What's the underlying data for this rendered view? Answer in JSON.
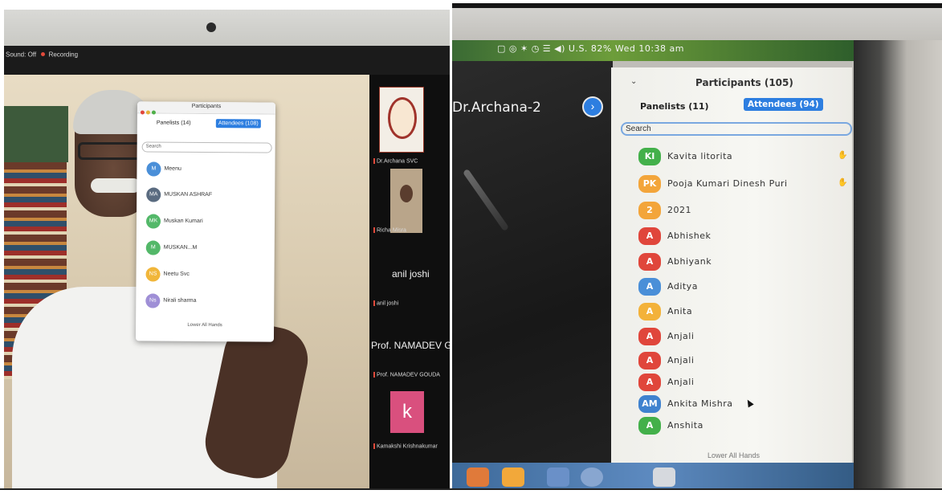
{
  "left": {
    "recording_bar": {
      "sound": "Sound: Off",
      "recording": "Recording"
    },
    "panel": {
      "title": "Participants",
      "tab_panelists": "Panelists (14)",
      "tab_attendees": "Attendees (108)",
      "search_placeholder": "Search",
      "participants": [
        {
          "initials": "M",
          "name": "Meenu",
          "color": "#4a8fd8"
        },
        {
          "initials": "MA",
          "name": "MUSKAN ASHRAF",
          "color": "#5a6b80"
        },
        {
          "initials": "MK",
          "name": "Muskan Kumari",
          "color": "#53b869"
        },
        {
          "initials": "M",
          "name": "MUSKAN...M",
          "color": "#53b869"
        },
        {
          "initials": "NS",
          "name": "Neetu Svc",
          "color": "#f1b63a"
        },
        {
          "initials": "Ns",
          "name": "Nirali sharma",
          "color": "#9f8fd6"
        }
      ],
      "lower_all_hands": "Lower All Hands"
    },
    "tiles": [
      {
        "label": "Dr.Archana SVC"
      },
      {
        "label": "Richa Misra"
      },
      {
        "big": "anil joshi",
        "label": "anil joshi"
      },
      {
        "big": "Prof. NAMADEV GOUDA",
        "label": "Prof. NAMADEV GOUDA"
      },
      {
        "letter": "k",
        "label": "Kamakshi Krishnakumar"
      }
    ]
  },
  "right": {
    "menubar": "▢ ◎  ✶  ◷  ☰  ◀)  U.S.  82%  Wed 10:38 am",
    "host_name": "Dr.Archana-2",
    "panel": {
      "title": "Participants (105)",
      "tab_panelists": "Panelists (11)",
      "tab_attendees": "Attendees (94)",
      "search_placeholder": "Search",
      "participants": [
        {
          "initials": "KI",
          "name": "Kavita litorita",
          "color": "#43b04a",
          "hand": true
        },
        {
          "initials": "PK",
          "name": "Pooja Kumari Dinesh Puri",
          "color": "#f3a53a",
          "hand": true
        },
        {
          "initials": "2",
          "name": "2021",
          "color": "#f3a53a",
          "hand": false
        },
        {
          "initials": "A",
          "name": "Abhishek",
          "color": "#e0463b",
          "hand": false
        },
        {
          "initials": "A",
          "name": "Abhiyank",
          "color": "#e0463b",
          "hand": false
        },
        {
          "initials": "A",
          "name": "Aditya",
          "color": "#4a8fd8",
          "hand": false
        },
        {
          "initials": "A",
          "name": "Anita",
          "color": "#f3b23a",
          "hand": false
        },
        {
          "initials": "A",
          "name": "Anjali",
          "color": "#e0463b",
          "hand": false
        },
        {
          "initials": "A",
          "name": "Anjali",
          "color": "#e0463b",
          "hand": false
        },
        {
          "initials": "A",
          "name": "Anjali",
          "color": "#e0463b",
          "hand": false
        },
        {
          "initials": "AM",
          "name": "Ankita Mishra",
          "color": "#3f82cf",
          "hand": false
        },
        {
          "initials": "A",
          "name": "Anshita",
          "color": "#43b04a",
          "hand": false
        }
      ],
      "lower_all_hands": "Lower All Hands"
    }
  }
}
